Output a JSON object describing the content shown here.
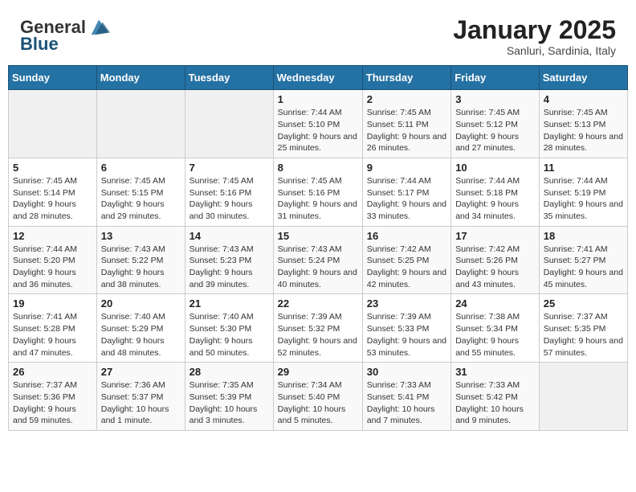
{
  "header": {
    "logo_general": "General",
    "logo_blue": "Blue",
    "month_title": "January 2025",
    "subtitle": "Sanluri, Sardinia, Italy"
  },
  "days_of_week": [
    "Sunday",
    "Monday",
    "Tuesday",
    "Wednesday",
    "Thursday",
    "Friday",
    "Saturday"
  ],
  "weeks": [
    [
      {
        "day": "",
        "info": ""
      },
      {
        "day": "",
        "info": ""
      },
      {
        "day": "",
        "info": ""
      },
      {
        "day": "1",
        "info": "Sunrise: 7:44 AM\nSunset: 5:10 PM\nDaylight: 9 hours and 25 minutes."
      },
      {
        "day": "2",
        "info": "Sunrise: 7:45 AM\nSunset: 5:11 PM\nDaylight: 9 hours and 26 minutes."
      },
      {
        "day": "3",
        "info": "Sunrise: 7:45 AM\nSunset: 5:12 PM\nDaylight: 9 hours and 27 minutes."
      },
      {
        "day": "4",
        "info": "Sunrise: 7:45 AM\nSunset: 5:13 PM\nDaylight: 9 hours and 28 minutes."
      }
    ],
    [
      {
        "day": "5",
        "info": "Sunrise: 7:45 AM\nSunset: 5:14 PM\nDaylight: 9 hours and 28 minutes."
      },
      {
        "day": "6",
        "info": "Sunrise: 7:45 AM\nSunset: 5:15 PM\nDaylight: 9 hours and 29 minutes."
      },
      {
        "day": "7",
        "info": "Sunrise: 7:45 AM\nSunset: 5:16 PM\nDaylight: 9 hours and 30 minutes."
      },
      {
        "day": "8",
        "info": "Sunrise: 7:45 AM\nSunset: 5:16 PM\nDaylight: 9 hours and 31 minutes."
      },
      {
        "day": "9",
        "info": "Sunrise: 7:44 AM\nSunset: 5:17 PM\nDaylight: 9 hours and 33 minutes."
      },
      {
        "day": "10",
        "info": "Sunrise: 7:44 AM\nSunset: 5:18 PM\nDaylight: 9 hours and 34 minutes."
      },
      {
        "day": "11",
        "info": "Sunrise: 7:44 AM\nSunset: 5:19 PM\nDaylight: 9 hours and 35 minutes."
      }
    ],
    [
      {
        "day": "12",
        "info": "Sunrise: 7:44 AM\nSunset: 5:20 PM\nDaylight: 9 hours and 36 minutes."
      },
      {
        "day": "13",
        "info": "Sunrise: 7:43 AM\nSunset: 5:22 PM\nDaylight: 9 hours and 38 minutes."
      },
      {
        "day": "14",
        "info": "Sunrise: 7:43 AM\nSunset: 5:23 PM\nDaylight: 9 hours and 39 minutes."
      },
      {
        "day": "15",
        "info": "Sunrise: 7:43 AM\nSunset: 5:24 PM\nDaylight: 9 hours and 40 minutes."
      },
      {
        "day": "16",
        "info": "Sunrise: 7:42 AM\nSunset: 5:25 PM\nDaylight: 9 hours and 42 minutes."
      },
      {
        "day": "17",
        "info": "Sunrise: 7:42 AM\nSunset: 5:26 PM\nDaylight: 9 hours and 43 minutes."
      },
      {
        "day": "18",
        "info": "Sunrise: 7:41 AM\nSunset: 5:27 PM\nDaylight: 9 hours and 45 minutes."
      }
    ],
    [
      {
        "day": "19",
        "info": "Sunrise: 7:41 AM\nSunset: 5:28 PM\nDaylight: 9 hours and 47 minutes."
      },
      {
        "day": "20",
        "info": "Sunrise: 7:40 AM\nSunset: 5:29 PM\nDaylight: 9 hours and 48 minutes."
      },
      {
        "day": "21",
        "info": "Sunrise: 7:40 AM\nSunset: 5:30 PM\nDaylight: 9 hours and 50 minutes."
      },
      {
        "day": "22",
        "info": "Sunrise: 7:39 AM\nSunset: 5:32 PM\nDaylight: 9 hours and 52 minutes."
      },
      {
        "day": "23",
        "info": "Sunrise: 7:39 AM\nSunset: 5:33 PM\nDaylight: 9 hours and 53 minutes."
      },
      {
        "day": "24",
        "info": "Sunrise: 7:38 AM\nSunset: 5:34 PM\nDaylight: 9 hours and 55 minutes."
      },
      {
        "day": "25",
        "info": "Sunrise: 7:37 AM\nSunset: 5:35 PM\nDaylight: 9 hours and 57 minutes."
      }
    ],
    [
      {
        "day": "26",
        "info": "Sunrise: 7:37 AM\nSunset: 5:36 PM\nDaylight: 9 hours and 59 minutes."
      },
      {
        "day": "27",
        "info": "Sunrise: 7:36 AM\nSunset: 5:37 PM\nDaylight: 10 hours and 1 minute."
      },
      {
        "day": "28",
        "info": "Sunrise: 7:35 AM\nSunset: 5:39 PM\nDaylight: 10 hours and 3 minutes."
      },
      {
        "day": "29",
        "info": "Sunrise: 7:34 AM\nSunset: 5:40 PM\nDaylight: 10 hours and 5 minutes."
      },
      {
        "day": "30",
        "info": "Sunrise: 7:33 AM\nSunset: 5:41 PM\nDaylight: 10 hours and 7 minutes."
      },
      {
        "day": "31",
        "info": "Sunrise: 7:33 AM\nSunset: 5:42 PM\nDaylight: 10 hours and 9 minutes."
      },
      {
        "day": "",
        "info": ""
      }
    ]
  ]
}
